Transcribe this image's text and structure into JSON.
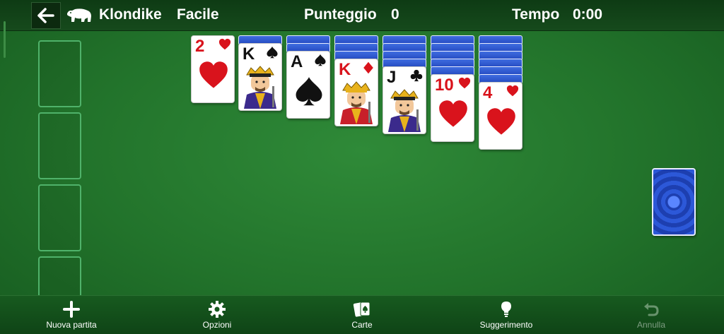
{
  "header": {
    "game_name": "Klondike",
    "difficulty": "Facile",
    "score_label": "Punteggio",
    "score_value": "0",
    "time_label": "Tempo",
    "time_value": "0:00"
  },
  "tableau": [
    {
      "rank": "2",
      "suit": "hearts",
      "face_down": 0
    },
    {
      "rank": "K",
      "suit": "spades",
      "face_down": 1
    },
    {
      "rank": "A",
      "suit": "spades",
      "face_down": 2
    },
    {
      "rank": "K",
      "suit": "diamonds",
      "face_down": 3
    },
    {
      "rank": "J",
      "suit": "clubs",
      "face_down": 4
    },
    {
      "rank": "10",
      "suit": "hearts",
      "face_down": 5
    },
    {
      "rank": "4",
      "suit": "hearts",
      "face_down": 6
    }
  ],
  "toolbar": {
    "new_game": "Nuova partita",
    "options": "Opzioni",
    "cards": "Carte",
    "hint": "Suggerimento",
    "undo": "Annulla"
  },
  "icons": {
    "back": "arrow-left-icon",
    "logo": "polar-bear-icon",
    "new_game": "plus-icon",
    "options": "gear-icon",
    "cards": "cards-icon",
    "hint": "lightbulb-icon",
    "undo": "undo-icon"
  },
  "colors": {
    "table_green": "#22732b",
    "card_red": "#d9131c",
    "card_back_blue": "#2348bf"
  }
}
